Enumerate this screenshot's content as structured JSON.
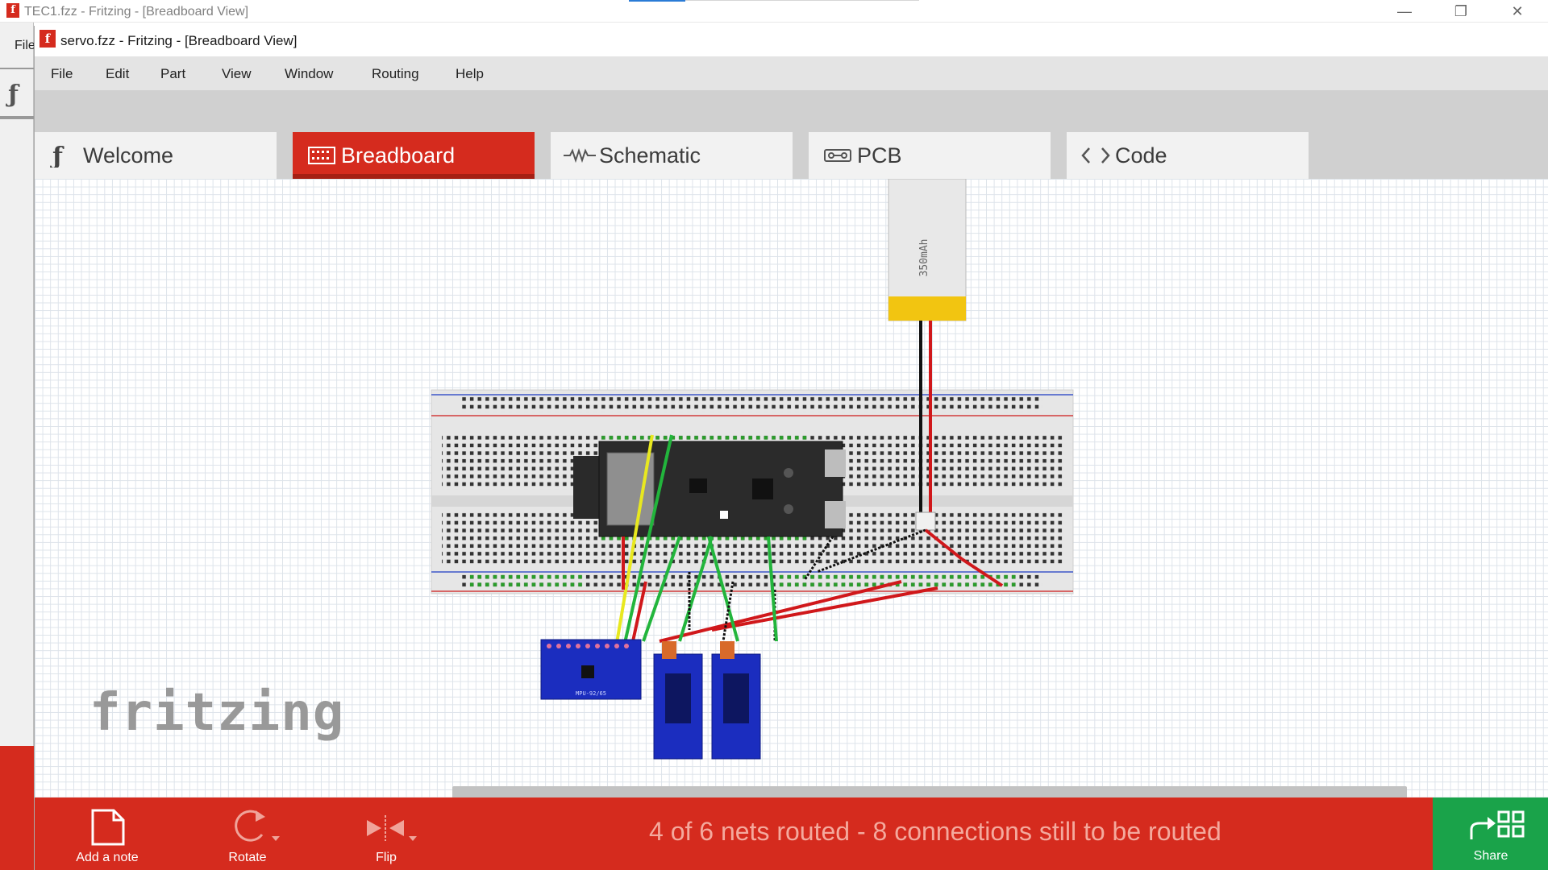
{
  "back_window": {
    "title": "TEC1.fzz - Fritzing - [Breadboard View]",
    "menu_file": "File",
    "logo_letter": "f"
  },
  "window": {
    "title": "servo.fzz - Fritzing - [Breadboard View]",
    "logo_letter": "f"
  },
  "menu": [
    "File",
    "Edit",
    "Part",
    "View",
    "Window",
    "Routing",
    "Help"
  ],
  "tabs": [
    {
      "label": "Welcome",
      "icon": "fritzing-f-icon"
    },
    {
      "label": "Breadboard",
      "icon": "breadboard-icon",
      "active": true
    },
    {
      "label": "Schematic",
      "icon": "resistor-icon"
    },
    {
      "label": "PCB",
      "icon": "pcb-icon"
    },
    {
      "label": "Code",
      "icon": "code-brackets-icon"
    }
  ],
  "canvas": {
    "watermark": "fritzing",
    "battery_label": "350mAh",
    "sensor_label": "MPU-92/65"
  },
  "toolbar": {
    "add_note": "Add a note",
    "rotate": "Rotate",
    "flip": "Flip",
    "share": "Share",
    "status": "4 of 6 nets routed - 8 connections still to be routed"
  },
  "colors": {
    "accent": "#d52b1e",
    "share": "#1aa34a",
    "wire_red": "#d0181b",
    "wire_green": "#22b53c",
    "wire_yellow": "#e8e81f",
    "wire_black": "#111111"
  }
}
